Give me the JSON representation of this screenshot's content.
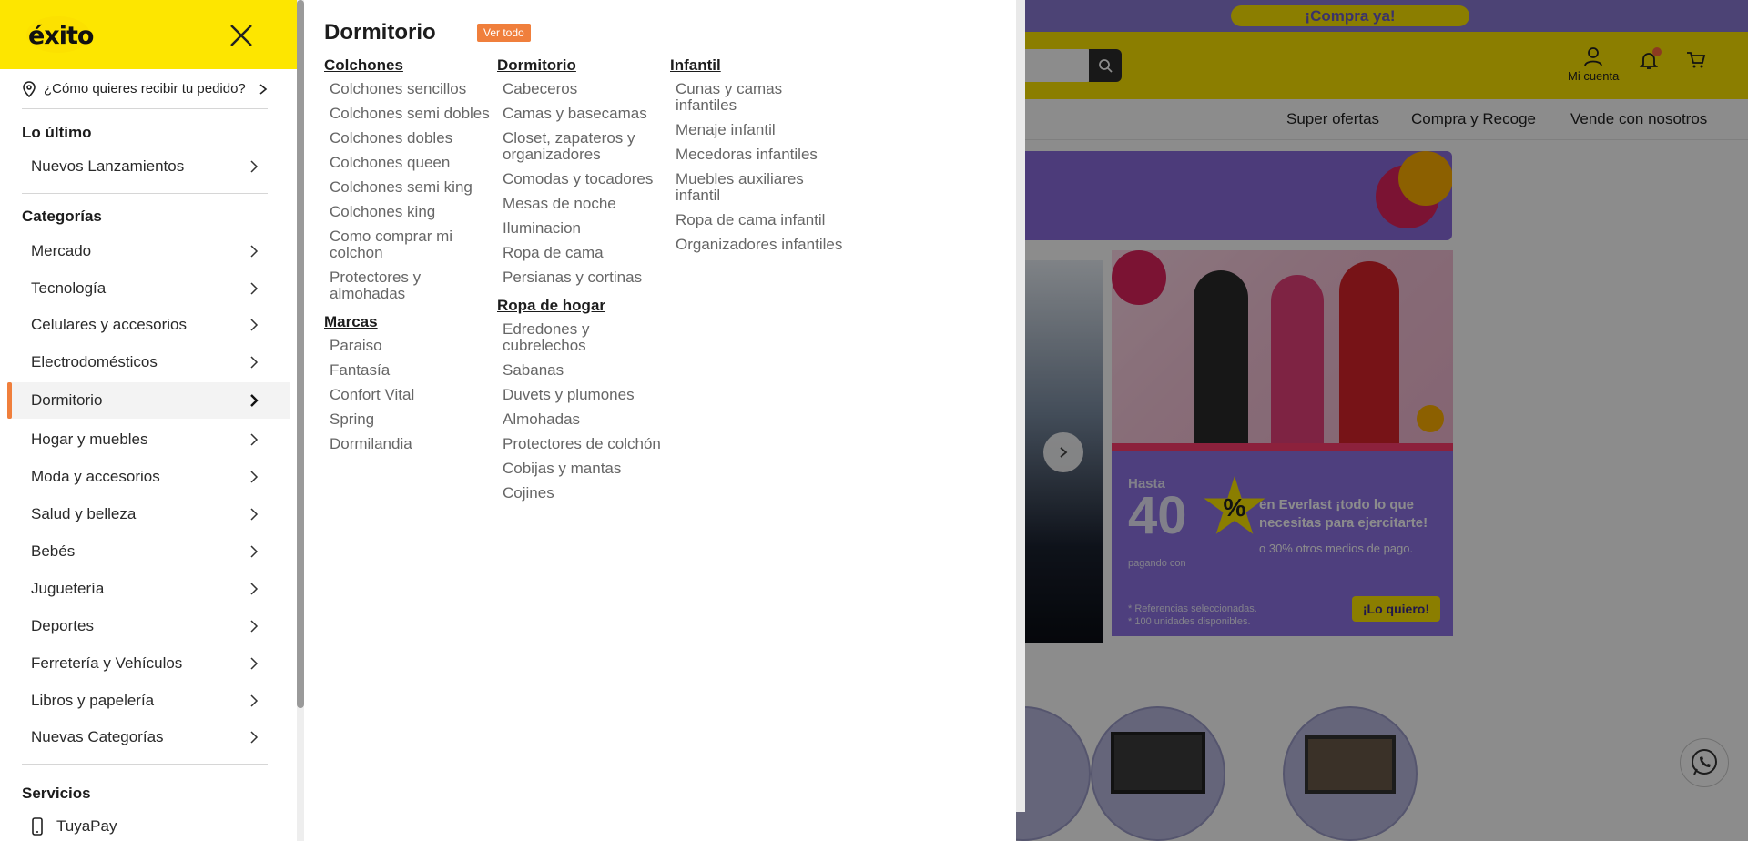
{
  "site": {
    "promo_button": "¡Compra ya!",
    "account_label": "Mi cuenta",
    "nav_links": [
      "Super ofertas",
      "Compra y Recoge",
      "Vende con nosotros"
    ],
    "promo": {
      "hasta": "Hasta",
      "percent": "40",
      "percent_sign": "%",
      "pagando": "pagando con",
      "message": "en Everlast ¡todo lo que necesitas para ejercitarte!",
      "message2": "o 30% otros medios de pago.",
      "note1": "* Referencias seleccionadas.",
      "note2": "* 100 unidades disponibles.",
      "cta": "¡Lo quiero!"
    }
  },
  "sidebar": {
    "logo": "éxito",
    "delivery_prompt": "¿Cómo quieres recibir tu pedido?",
    "latest_title": "Lo último",
    "latest_items": [
      "Nuevos Lanzamientos"
    ],
    "categories_title": "Categorías",
    "categories": [
      "Mercado",
      "Tecnología",
      "Celulares y accesorios",
      "Electrodomésticos",
      "Dormitorio",
      "Hogar y muebles",
      "Moda y accesorios",
      "Salud y belleza",
      "Bebés",
      "Juguetería",
      "Deportes",
      "Ferretería y Vehículos",
      "Libros y papelería",
      "Nuevas Categorías"
    ],
    "active_category": "Dormitorio",
    "services_title": "Servicios",
    "services": [
      "TuyaPay"
    ]
  },
  "submenu": {
    "title": "Dormitorio",
    "see_all": "Ver todo",
    "col1": {
      "g1_title": "Colchones",
      "g1_links": [
        "Colchones sencillos",
        "Colchones semi dobles",
        "Colchones dobles",
        "Colchones queen",
        "Colchones semi king",
        "Colchones king",
        "Como comprar mi colchon",
        "Protectores y almohadas"
      ],
      "g2_title": "Marcas",
      "g2_links": [
        "Paraiso",
        "Fantasía",
        "Confort Vital",
        "Spring",
        "Dormilandia"
      ]
    },
    "col2": {
      "g1_title": "Dormitorio",
      "g1_links": [
        "Cabeceros",
        "Camas y basecamas",
        "Closet, zapateros y organizadores",
        "Comodas y tocadores",
        "Mesas de noche",
        "Iluminacion",
        "Ropa de cama",
        "Persianas y cortinas"
      ],
      "g2_title": "Ropa de hogar",
      "g2_links": [
        "Edredones y cubrelechos",
        "Sabanas",
        "Duvets y plumones",
        "Almohadas",
        "Protectores de colchón",
        "Cobijas y mantas",
        "Cojines"
      ]
    },
    "col3": {
      "g1_title": "Infantil",
      "g1_links": [
        "Cunas y camas infantiles",
        "Menaje infantil",
        "Mecedoras infantiles",
        "Muebles auxiliares infantil",
        "Ropa de cama infantil",
        "Organizadores infantiles"
      ]
    }
  },
  "colors": {
    "brand_yellow": "#fde600",
    "accent_orange": "#f07f3c",
    "promo_purple": "#8a7bd6"
  }
}
